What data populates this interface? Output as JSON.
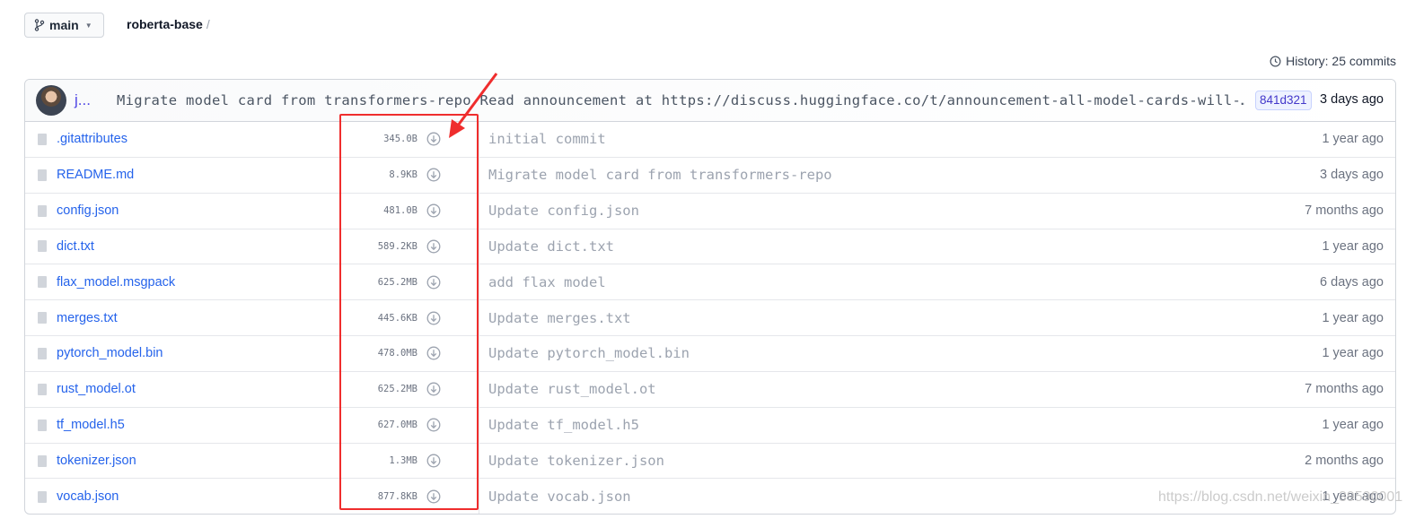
{
  "header": {
    "branch": "main",
    "repo": "roberta-base",
    "history_label": "History: 25 commits"
  },
  "latest_commit": {
    "author": "j...",
    "message": "Migrate model card from transformers-repo Read announcement at https://discuss.huggingface.co/t/announcement-all-model-cards-will-…",
    "sha": "841d321",
    "date": "3 days ago"
  },
  "files": [
    {
      "name": ".gitattributes",
      "size": "345.0B",
      "commit": "initial commit",
      "date": "1 year ago"
    },
    {
      "name": "README.md",
      "size": "8.9KB",
      "commit": "Migrate model card from transformers-repo",
      "date": "3 days ago"
    },
    {
      "name": "config.json",
      "size": "481.0B",
      "commit": "Update config.json",
      "date": "7 months ago"
    },
    {
      "name": "dict.txt",
      "size": "589.2KB",
      "commit": "Update dict.txt",
      "date": "1 year ago"
    },
    {
      "name": "flax_model.msgpack",
      "size": "625.2MB",
      "commit": "add flax model",
      "date": "6 days ago"
    },
    {
      "name": "merges.txt",
      "size": "445.6KB",
      "commit": "Update merges.txt",
      "date": "1 year ago"
    },
    {
      "name": "pytorch_model.bin",
      "size": "478.0MB",
      "commit": "Update pytorch_model.bin",
      "date": "1 year ago"
    },
    {
      "name": "rust_model.ot",
      "size": "625.2MB",
      "commit": "Update rust_model.ot",
      "date": "7 months ago"
    },
    {
      "name": "tf_model.h5",
      "size": "627.0MB",
      "commit": "Update tf_model.h5",
      "date": "1 year ago"
    },
    {
      "name": "tokenizer.json",
      "size": "1.3MB",
      "commit": "Update tokenizer.json",
      "date": "2 months ago"
    },
    {
      "name": "vocab.json",
      "size": "877.8KB",
      "commit": "Update vocab.json",
      "date": "1 year ago"
    }
  ],
  "annotation": {
    "color": "#ef2d2d"
  },
  "watermark": "https://blog.csdn.net/weixin_39590001"
}
